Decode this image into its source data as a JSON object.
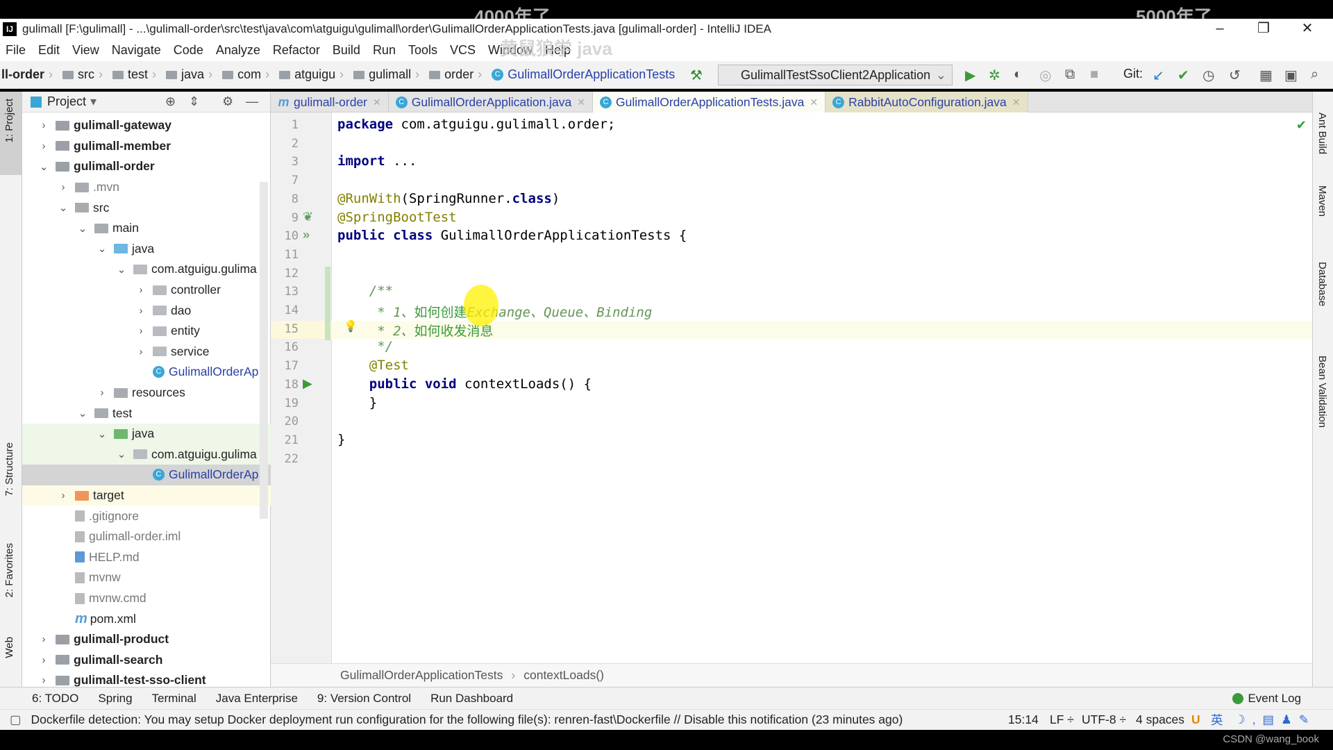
{
  "overlay": {
    "watermark1": "4000年了",
    "watermark2": "5000年了",
    "watermark3": "黄鼠狼学 java",
    "credit": "CSDN @wang_book"
  },
  "window": {
    "title": "gulimall [F:\\gulimall] - ...\\gulimall-order\\src\\test\\java\\com\\atguigu\\gulimall\\order\\GulimallOrderApplicationTests.java [gulimall-order] - IntelliJ IDEA",
    "minimize": "–",
    "restore": "❐",
    "close": "✕"
  },
  "menu": [
    "File",
    "Edit",
    "View",
    "Navigate",
    "Code",
    "Analyze",
    "Refactor",
    "Build",
    "Run",
    "Tools",
    "VCS",
    "Window",
    "Help"
  ],
  "nav": {
    "crumbs": [
      "ll-order",
      "src",
      "test",
      "java",
      "com",
      "atguigu",
      "gulimall",
      "order"
    ],
    "current": "GulimallOrderApplicationTests",
    "run_config": "GulimallTestSsoClient2Application",
    "git": "Git:"
  },
  "project": {
    "title": "Project",
    "tree": [
      {
        "label": "gulimall-gateway",
        "depth": 0,
        "arrow": "›",
        "kind": "module",
        "bold": true
      },
      {
        "label": "gulimall-member",
        "depth": 0,
        "arrow": "›",
        "kind": "module",
        "bold": true
      },
      {
        "label": "gulimall-order",
        "depth": 0,
        "arrow": "⌄",
        "kind": "module",
        "bold": true
      },
      {
        "label": ".mvn",
        "depth": 1,
        "arrow": "›",
        "kind": "folder",
        "muted": true
      },
      {
        "label": "src",
        "depth": 1,
        "arrow": "⌄",
        "kind": "folder"
      },
      {
        "label": "main",
        "depth": 2,
        "arrow": "⌄",
        "kind": "folder"
      },
      {
        "label": "java",
        "depth": 3,
        "arrow": "⌄",
        "kind": "src"
      },
      {
        "label": "com.atguigu.gulima",
        "depth": 4,
        "arrow": "⌄",
        "kind": "pkg"
      },
      {
        "label": "controller",
        "depth": 5,
        "arrow": "›",
        "kind": "pkg"
      },
      {
        "label": "dao",
        "depth": 5,
        "arrow": "›",
        "kind": "pkg"
      },
      {
        "label": "entity",
        "depth": 5,
        "arrow": "›",
        "kind": "pkg"
      },
      {
        "label": "service",
        "depth": 5,
        "arrow": "›",
        "kind": "pkg"
      },
      {
        "label": "GulimallOrderAp",
        "depth": 5,
        "arrow": "",
        "kind": "class"
      },
      {
        "label": "resources",
        "depth": 3,
        "arrow": "›",
        "kind": "res"
      },
      {
        "label": "test",
        "depth": 2,
        "arrow": "⌄",
        "kind": "folder"
      },
      {
        "label": "java",
        "depth": 3,
        "arrow": "⌄",
        "kind": "test",
        "hl": "green"
      },
      {
        "label": "com.atguigu.gulima",
        "depth": 4,
        "arrow": "⌄",
        "kind": "pkg",
        "hl": "green"
      },
      {
        "label": "GulimallOrderAp",
        "depth": 5,
        "arrow": "",
        "kind": "class",
        "hl": "sel"
      },
      {
        "label": "target",
        "depth": 1,
        "arrow": "›",
        "kind": "target",
        "hl": "yellow"
      },
      {
        "label": ".gitignore",
        "depth": 1,
        "arrow": "",
        "kind": "file",
        "muted": true
      },
      {
        "label": "gulimall-order.iml",
        "depth": 1,
        "arrow": "",
        "kind": "file",
        "muted": true
      },
      {
        "label": "HELP.md",
        "depth": 1,
        "arrow": "",
        "kind": "md",
        "muted": true
      },
      {
        "label": "mvnw",
        "depth": 1,
        "arrow": "",
        "kind": "file",
        "muted": true
      },
      {
        "label": "mvnw.cmd",
        "depth": 1,
        "arrow": "",
        "kind": "file",
        "muted": true
      },
      {
        "label": "pom.xml",
        "depth": 1,
        "arrow": "",
        "kind": "maven"
      },
      {
        "label": "gulimall-product",
        "depth": 0,
        "arrow": "›",
        "kind": "module",
        "bold": true
      },
      {
        "label": "gulimall-search",
        "depth": 0,
        "arrow": "›",
        "kind": "module",
        "bold": true
      },
      {
        "label": "gulimall-test-sso-client",
        "depth": 0,
        "arrow": "›",
        "kind": "module",
        "bold": true
      }
    ]
  },
  "tabs": [
    {
      "label": "gulimall-order",
      "icon": "m"
    },
    {
      "label": "GulimallOrderApplication.java",
      "icon": "c"
    },
    {
      "label": "GulimallOrderApplicationTests.java",
      "icon": "c",
      "active": true
    },
    {
      "label": "RabbitAutoConfiguration.java",
      "icon": "c"
    }
  ],
  "editor": {
    "lines": [
      {
        "n": "1",
        "t": [
          [
            "kw",
            "package "
          ],
          [
            "",
            "com.atguigu.gulimall.order;"
          ]
        ]
      },
      {
        "n": "2",
        "t": []
      },
      {
        "n": "3",
        "t": [
          [
            "kw",
            "import "
          ],
          [
            "",
            "..."
          ]
        ]
      },
      {
        "n": "7",
        "t": []
      },
      {
        "n": "8",
        "t": [
          [
            "ann",
            "@RunWith"
          ],
          [
            "",
            "(SpringRunner."
          ],
          [
            "kw",
            "class"
          ],
          [
            "",
            ")"
          ]
        ]
      },
      {
        "n": "9",
        "t": [
          [
            "ann",
            "@SpringBootTest"
          ]
        ]
      },
      {
        "n": "10",
        "t": [
          [
            "kw",
            "public class "
          ],
          [
            "",
            "GulimallOrderApplicationTests {"
          ]
        ]
      },
      {
        "n": "11",
        "t": []
      },
      {
        "n": "12",
        "t": []
      },
      {
        "n": "13",
        "t": [
          [
            "cm",
            "    /**"
          ]
        ]
      },
      {
        "n": "14",
        "t": [
          [
            "cm",
            "     * 1、"
          ],
          [
            "cmc",
            "如何创建"
          ],
          [
            "cm",
            "Exchange、Queue、Binding"
          ]
        ]
      },
      {
        "n": "15",
        "t": [
          [
            "cm",
            "     * 2、"
          ],
          [
            "cmc",
            "如何收发消息"
          ]
        ],
        "current": true
      },
      {
        "n": "16",
        "t": [
          [
            "cm",
            "     */"
          ]
        ]
      },
      {
        "n": "17",
        "t": [
          [
            "ann",
            "    @Test"
          ]
        ]
      },
      {
        "n": "18",
        "t": [
          [
            "kw",
            "    public void "
          ],
          [
            "",
            "contextLoads() {"
          ]
        ]
      },
      {
        "n": "19",
        "t": [
          [
            "",
            "    }"
          ]
        ]
      },
      {
        "n": "20",
        "t": []
      },
      {
        "n": "21",
        "t": [
          [
            "",
            "}"
          ]
        ]
      },
      {
        "n": "22",
        "t": []
      }
    ],
    "breadcrumb": [
      "GulimallOrderApplicationTests",
      "contextLoads()"
    ]
  },
  "side_right": [
    "Ant Build",
    "Maven",
    "Database",
    "Bean Validation"
  ],
  "side_left": [
    "1: Project",
    "7: Structure",
    "2: Favorites",
    "Web"
  ],
  "toolwindows": [
    "6: TODO",
    "Spring",
    "Terminal",
    "Java Enterprise",
    "9: Version Control",
    "Run Dashboard"
  ],
  "event_log": "Event Log",
  "status": {
    "message": "Dockerfile detection: You may setup Docker deployment run configuration for the following file(s): renren-fast\\Dockerfile // Disable this notification (23 minutes ago)",
    "position": "15:14",
    "line_sep": "LF ÷",
    "encoding": "UTF-8 ÷",
    "indent": "4 spaces",
    "ime": "英"
  },
  "colors": {
    "keyword": "#000080",
    "annotation": "#808000",
    "comment": "#629755",
    "accent": "#2a40a8"
  }
}
